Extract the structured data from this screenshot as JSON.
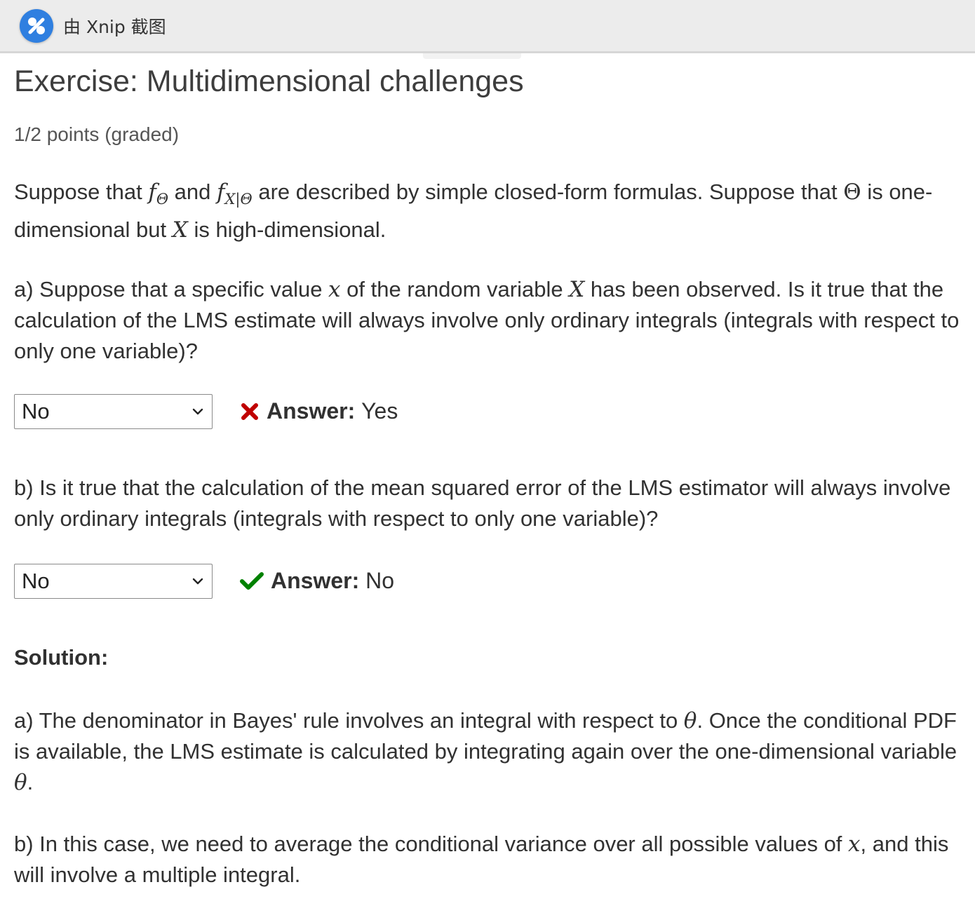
{
  "topbar": {
    "brand": "由 Xnip 截图",
    "logo_icon": "xnip-logo-icon",
    "logo_color": "#2f7fe0"
  },
  "exercise": {
    "title": "Exercise: Multidimensional challenges",
    "points": "1/2 points (graded)"
  },
  "intro": {
    "t1": "Suppose that ",
    "f": "f",
    "sub_theta": "Θ",
    "t2": " and ",
    "f2": "f",
    "sub_xtheta": "X|Θ",
    "t3": " are described by simple closed-form formulas. Suppose that ",
    "theta": "Θ",
    "t4": " is one-dimensional but ",
    "X": "X",
    "t5": " is high-dimensional."
  },
  "question_a": {
    "t1": "a) Suppose that a specific value ",
    "x": "x",
    "t2": " of the random variable ",
    "X": "X",
    "t3": " has been observed. Is it true that the calculation of the LMS estimate will always involve only ordinary integrals (integrals with respect to only one variable)?",
    "selected": "No",
    "result_icon": "cross-icon",
    "result_color": "#c00000",
    "answer_label": "Answer:",
    "answer_value": "Yes"
  },
  "question_b": {
    "text": "b) Is it true that the calculation of the mean squared error of the LMS estimator will always involve only ordinary integrals (integrals with respect to only one variable)?",
    "selected": "No",
    "result_icon": "check-icon",
    "result_color": "#008100",
    "answer_label": "Answer:",
    "answer_value": "No"
  },
  "solution": {
    "heading": "Solution:",
    "a_t1": "a) The denominator in Bayes' rule involves an integral with respect to ",
    "theta": "θ",
    "a_t2": ". Once the conditional PDF is available, the LMS estimate is calculated by integrating again over the one-dimensional variable ",
    "theta2": "θ",
    "a_t3": ".",
    "b_t1": "b) In this case, we need to average the conditional variance over all possible values of ",
    "x": "x",
    "b_t2": ", and this will involve a multiple integral."
  }
}
